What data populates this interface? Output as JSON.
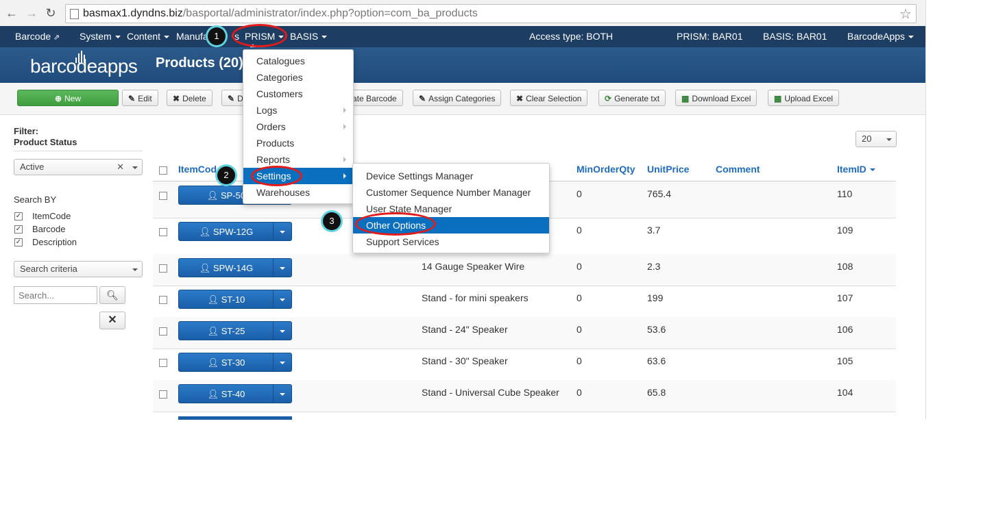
{
  "browser": {
    "url_host": "basmax1.dyndns.biz",
    "url_path": "/basportal/administrator/index.php?option=com_ba_products"
  },
  "topnav": {
    "barcode": "Barcode",
    "system": "System",
    "content": "Content",
    "manufactures_left": "Manufa",
    "manufactures_right": "s",
    "prism": "PRISM",
    "basis": "BASIS",
    "access_type": "Access type: BOTH",
    "prism_id": "PRISM: BAR01",
    "basis_id": "BASIS: BAR01",
    "barcodeapps": "BarcodeApps"
  },
  "header": {
    "logo_text": "barcodeapps",
    "title": "Products (20)"
  },
  "toolbar": {
    "new": "New",
    "edit": "Edit",
    "delete": "Delete",
    "dup_partial": "D",
    "generate_barcode_partial": "rate Barcode",
    "assign_categories": "Assign Categories",
    "clear_selection": "Clear Selection",
    "generate_txt": "Generate txt",
    "download_excel": "Download Excel",
    "upload_excel": "Upload Excel"
  },
  "sidebar": {
    "filter_label": "Filter:",
    "status_label": "Product Status",
    "status_value": "Active",
    "search_by": "Search BY",
    "options": [
      "ItemCode",
      "Barcode",
      "Description"
    ],
    "criteria_value": "Search criteria",
    "search_placeholder": "Search..."
  },
  "limit": "20",
  "table": {
    "headers": {
      "itemcode": "ItemCod",
      "minorderqty": "MinOrderQty",
      "unitprice": "UnitPrice",
      "comment": "Comment",
      "itemid": "ItemID"
    },
    "rows": [
      {
        "code": "SP-50",
        "desc": "",
        "min": "0",
        "price": "765.4",
        "id": "110"
      },
      {
        "code": "SPW-12G",
        "desc": "r",
        "min": "0",
        "price": "3.7",
        "id": "109"
      },
      {
        "code": "SPW-14G",
        "desc": "14 Gauge Speaker Wire",
        "min": "0",
        "price": "2.3",
        "id": "108"
      },
      {
        "code": "ST-10",
        "desc": "Stand - for mini speakers",
        "min": "0",
        "price": "199",
        "id": "107"
      },
      {
        "code": "ST-25",
        "desc": "Stand - 24\" Speaker",
        "min": "0",
        "price": "53.6",
        "id": "106"
      },
      {
        "code": "ST-30",
        "desc": "Stand - 30\" Speaker",
        "min": "0",
        "price": "63.6",
        "id": "105"
      },
      {
        "code": "ST-40",
        "desc": "Stand - Universal Cube Speaker",
        "min": "0",
        "price": "65.8",
        "id": "104"
      }
    ]
  },
  "prism_menu": [
    "Catalogues",
    "Categories",
    "Customers",
    "Logs",
    "Orders",
    "Products",
    "Reports",
    "Settings",
    "Warehouses"
  ],
  "settings_menu": [
    "Device Settings Manager",
    "Customer Sequence Number Manager",
    "User State Manager",
    "Other Options",
    "Support Services"
  ],
  "badges": [
    "1",
    "2",
    "3"
  ],
  "colors": {
    "navbar": "#1d3d63",
    "accent_blue": "#0a6fbe",
    "annotation_red": "#e21b1b",
    "new_green": "#4aa84a"
  }
}
